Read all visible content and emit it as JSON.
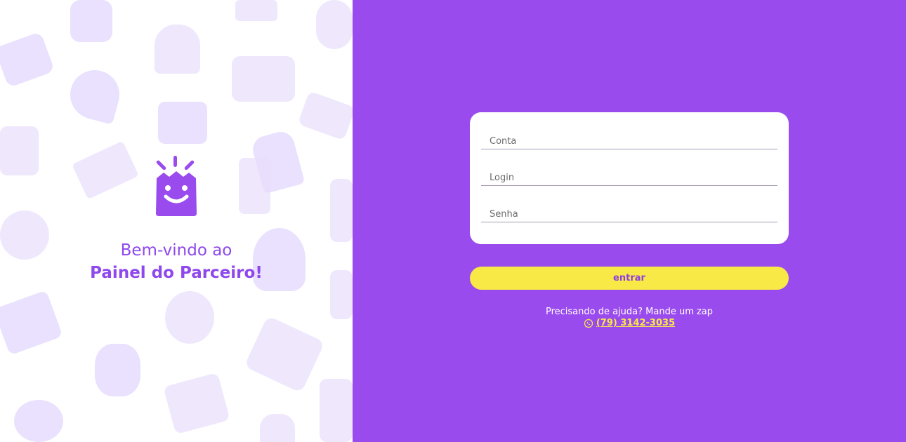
{
  "brand": {
    "welcome_line": "Bem-vindo ao",
    "title_line": "Painel do Parceiro!"
  },
  "login_form": {
    "account_placeholder": "Conta",
    "login_placeholder": "Login",
    "password_placeholder": "Senha",
    "submit_label": "entrar"
  },
  "help": {
    "text": "Precisando de ajuda? Mande um zap",
    "phone": "(79) 3142-3035",
    "icon": "whatsapp-icon"
  },
  "colors": {
    "brand_purple": "#9a4bee",
    "button_yellow": "#f8e946",
    "text_purple": "#8e48ec"
  }
}
